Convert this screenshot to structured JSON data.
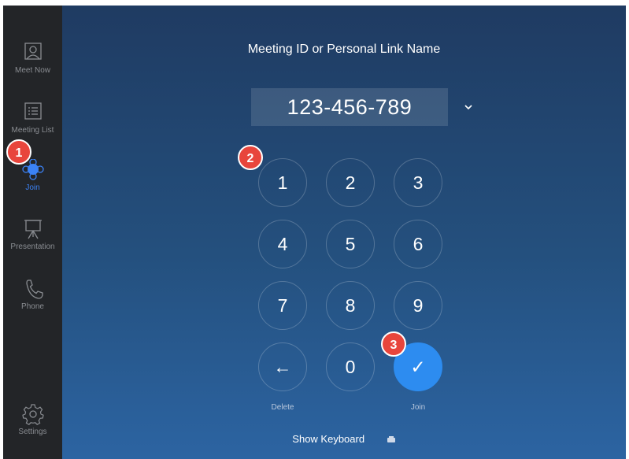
{
  "sidebar": {
    "items": [
      {
        "label": "Meet Now",
        "icon": "person-frame-icon"
      },
      {
        "label": "Meeting List",
        "icon": "list-icon"
      },
      {
        "label": "Join",
        "icon": "join-icon",
        "active": true
      },
      {
        "label": "Presentation",
        "icon": "presentation-icon"
      },
      {
        "label": "Phone",
        "icon": "phone-icon"
      }
    ],
    "settings_label": "Settings"
  },
  "main": {
    "title": "Meeting ID or Personal Link Name",
    "meeting_id_value": "123-456-789",
    "keys": [
      "1",
      "2",
      "3",
      "4",
      "5",
      "6",
      "7",
      "8",
      "9",
      "←",
      "0",
      "✓"
    ],
    "delete_label": "Delete",
    "join_label": "Join",
    "show_keyboard_label": "Show Keyboard"
  },
  "annotations": [
    "1",
    "2",
    "3"
  ],
  "colors": {
    "accent": "#2d8cf0",
    "sidebar_bg": "#232528",
    "badge": "#e8453c"
  }
}
